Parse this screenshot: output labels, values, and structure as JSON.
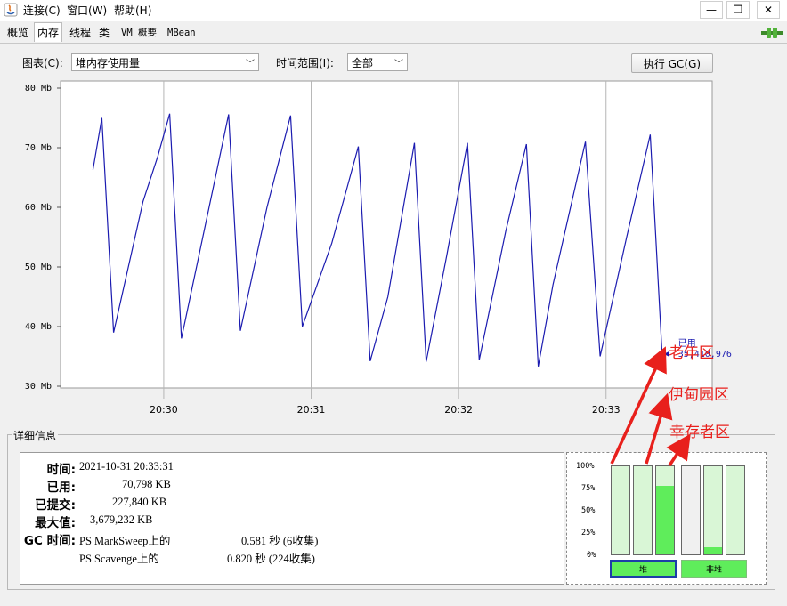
{
  "menu": {
    "connect": "连接(C)",
    "window": "窗口(W)",
    "help": "帮助(H)"
  },
  "tabs": [
    {
      "label": "概览",
      "active": false
    },
    {
      "label": "内存",
      "active": true
    },
    {
      "label": "线程",
      "active": false
    },
    {
      "label": "类",
      "active": false
    },
    {
      "label": "VM 概要",
      "active": false
    },
    {
      "label": "MBean",
      "active": false
    }
  ],
  "controls": {
    "chart_label": "图表(C):",
    "chart_value": "堆内存使用量",
    "range_label": "时间范围(I):",
    "range_value": "全部",
    "gc_button": "执行 GC(G)"
  },
  "chart_data": {
    "type": "line",
    "ylim": [
      30,
      80
    ],
    "y_ticks": [
      "80 Mb",
      "70 Mb",
      "60 Mb",
      "50 Mb",
      "40 Mb",
      "30 Mb"
    ],
    "x_ticks": [
      "20:30",
      "20:31",
      "20:32",
      "20:33"
    ],
    "series": [
      {
        "name": "已用",
        "color": "#1b1bb0",
        "points": [
          [
            20.52,
            66.3
          ],
          [
            20.58,
            75.0
          ],
          [
            20.66,
            39.0
          ],
          [
            20.86,
            61.0
          ],
          [
            20.96,
            68.6
          ],
          [
            21.04,
            75.7
          ],
          [
            21.12,
            38.0
          ],
          [
            21.35,
            65.0
          ],
          [
            21.44,
            75.6
          ],
          [
            21.52,
            39.3
          ],
          [
            21.7,
            60.0
          ],
          [
            21.86,
            75.4
          ],
          [
            21.94,
            40.0
          ],
          [
            22.06,
            48.4
          ],
          [
            22.14,
            54.0
          ],
          [
            22.24,
            63.0
          ],
          [
            22.32,
            70.2
          ],
          [
            22.4,
            34.2
          ],
          [
            22.52,
            45.0
          ],
          [
            22.7,
            70.8
          ],
          [
            22.78,
            34.1
          ],
          [
            22.92,
            52.0
          ],
          [
            23.06,
            70.8
          ],
          [
            23.14,
            34.4
          ],
          [
            23.32,
            56.0
          ],
          [
            23.46,
            70.6
          ],
          [
            23.54,
            33.3
          ],
          [
            23.64,
            47.0
          ],
          [
            23.86,
            71.0
          ],
          [
            23.96,
            35.0
          ],
          [
            24.14,
            55.0
          ],
          [
            24.3,
            72.2
          ],
          [
            24.38,
            35.4
          ]
        ],
        "last_value_label": "35,410,976"
      }
    ]
  },
  "details": {
    "legend": "详细信息",
    "time_label": "时间:",
    "time_value": "2021-10-31 20:33:31",
    "used_label": "已用:",
    "used_value": "70,798 KB",
    "committed_label": "已提交:",
    "committed_value": "227,840 KB",
    "max_label": "最大值:",
    "max_value": "3,679,232 KB",
    "gc_label": "GC 时间:",
    "gc_rows": [
      {
        "name": "PS MarkSweep上的",
        "value": "0.581 秒 (6收集)"
      },
      {
        "name": "PS Scavenge上的",
        "value": "0.820 秒 (224收集)"
      }
    ]
  },
  "pools": {
    "pct_labels": [
      "100%",
      "75%",
      "50%",
      "25%",
      "0%"
    ],
    "bar_fills": [
      0,
      0,
      0.78,
      0,
      0.08,
      0
    ],
    "heap_button": "堆",
    "nonheap_button": "非堆"
  },
  "annotations": {
    "old_gen": "老年区",
    "eden": "伊甸园区",
    "survivor": "幸存者区"
  }
}
